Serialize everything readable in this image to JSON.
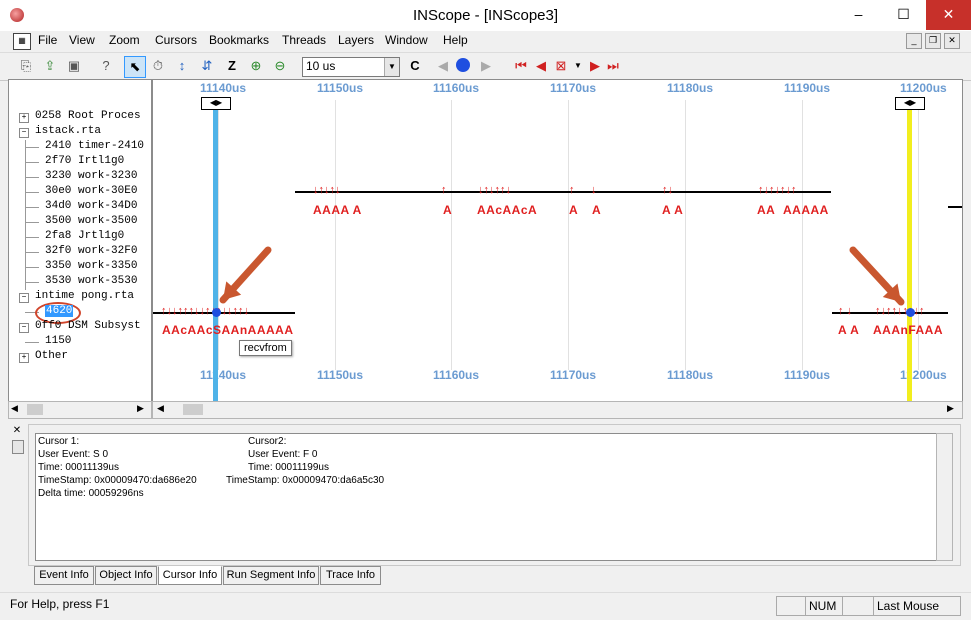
{
  "window": {
    "title": "INScope - [INScope3]",
    "minimize": "–",
    "maximize": "☐",
    "close": "✕"
  },
  "menu": [
    "File",
    "View",
    "Zoom",
    "Cursors",
    "Bookmarks",
    "Threads",
    "Layers",
    "Window",
    "Help"
  ],
  "toolbar": {
    "zoom_value": "10 us"
  },
  "tree": {
    "items": [
      {
        "expander": "+",
        "label": "0258 Root Proces",
        "depth": 0
      },
      {
        "expander": "−",
        "label": "istack.rta",
        "depth": 0
      },
      {
        "expander": "",
        "label": "2410 timer-2410",
        "depth": 1
      },
      {
        "expander": "",
        "label": "2f70 Irtl1g0",
        "depth": 1
      },
      {
        "expander": "",
        "label": "3230 work-3230",
        "depth": 1
      },
      {
        "expander": "",
        "label": "30e0 work-30E0",
        "depth": 1
      },
      {
        "expander": "",
        "label": "34d0 work-34D0",
        "depth": 1
      },
      {
        "expander": "",
        "label": "3500 work-3500",
        "depth": 1
      },
      {
        "expander": "",
        "label": "2fa8 Jrtl1g0",
        "depth": 1
      },
      {
        "expander": "",
        "label": "32f0 work-32F0",
        "depth": 1
      },
      {
        "expander": "",
        "label": "3350 work-3350",
        "depth": 1
      },
      {
        "expander": "",
        "label": "3530 work-3530",
        "depth": 1
      },
      {
        "expander": "−",
        "label": "intime pong.rta",
        "depth": 0
      },
      {
        "expander": "",
        "label": "4620",
        "depth": 1
      },
      {
        "expander": "−",
        "label": "0ff0 DSM Subsyst",
        "depth": 0
      },
      {
        "expander": "",
        "label": "1150",
        "depth": 1
      },
      {
        "expander": "+",
        "label": "Other",
        "depth": 0
      }
    ]
  },
  "timeline": {
    "ticks": [
      "11140us",
      "11150us",
      "11160us",
      "11170us",
      "11180us",
      "11190us",
      "11200us"
    ],
    "row1_labels": [
      {
        "text": "AAAA A"
      },
      {
        "text": "A"
      },
      {
        "text": "AAcAAcA"
      },
      {
        "text": "A"
      },
      {
        "text": "A"
      },
      {
        "text": "A A"
      },
      {
        "text": "AA"
      },
      {
        "text": "AAAAA"
      }
    ],
    "row2_labels": [
      {
        "text": "AAcAAcSAAnAAAAA"
      },
      {
        "text": "A A"
      },
      {
        "text": "AAAnFAAA"
      }
    ],
    "tooltip": "recvfrom",
    "cursor1_color": "#4fb3e8",
    "cursor2_color": "#f2ee1e",
    "event_color": "#e02020",
    "tick_color": "#6b9bd1"
  },
  "cursor_info": {
    "cursor1": {
      "title": "Cursor 1:",
      "user_event": "User Event: S  0",
      "time": "Time: 00011139us",
      "timestamp": "TimeStamp: 0x00009470:da686e20",
      "delta": "Delta time: 00059296ns"
    },
    "cursor2": {
      "title": "Cursor2:",
      "user_event": "User Event: F  0",
      "time": "Time: 00011199us",
      "timestamp": "TimeStamp: 0x00009470:da6a5c30"
    }
  },
  "tabs": [
    "Event Info",
    "Object Info",
    "Cursor Info",
    "Run Segment Info",
    "Trace Info"
  ],
  "active_tab": "Cursor Info",
  "status": {
    "help": "For Help, press F1",
    "num": "NUM",
    "last": "Last Mouse"
  }
}
